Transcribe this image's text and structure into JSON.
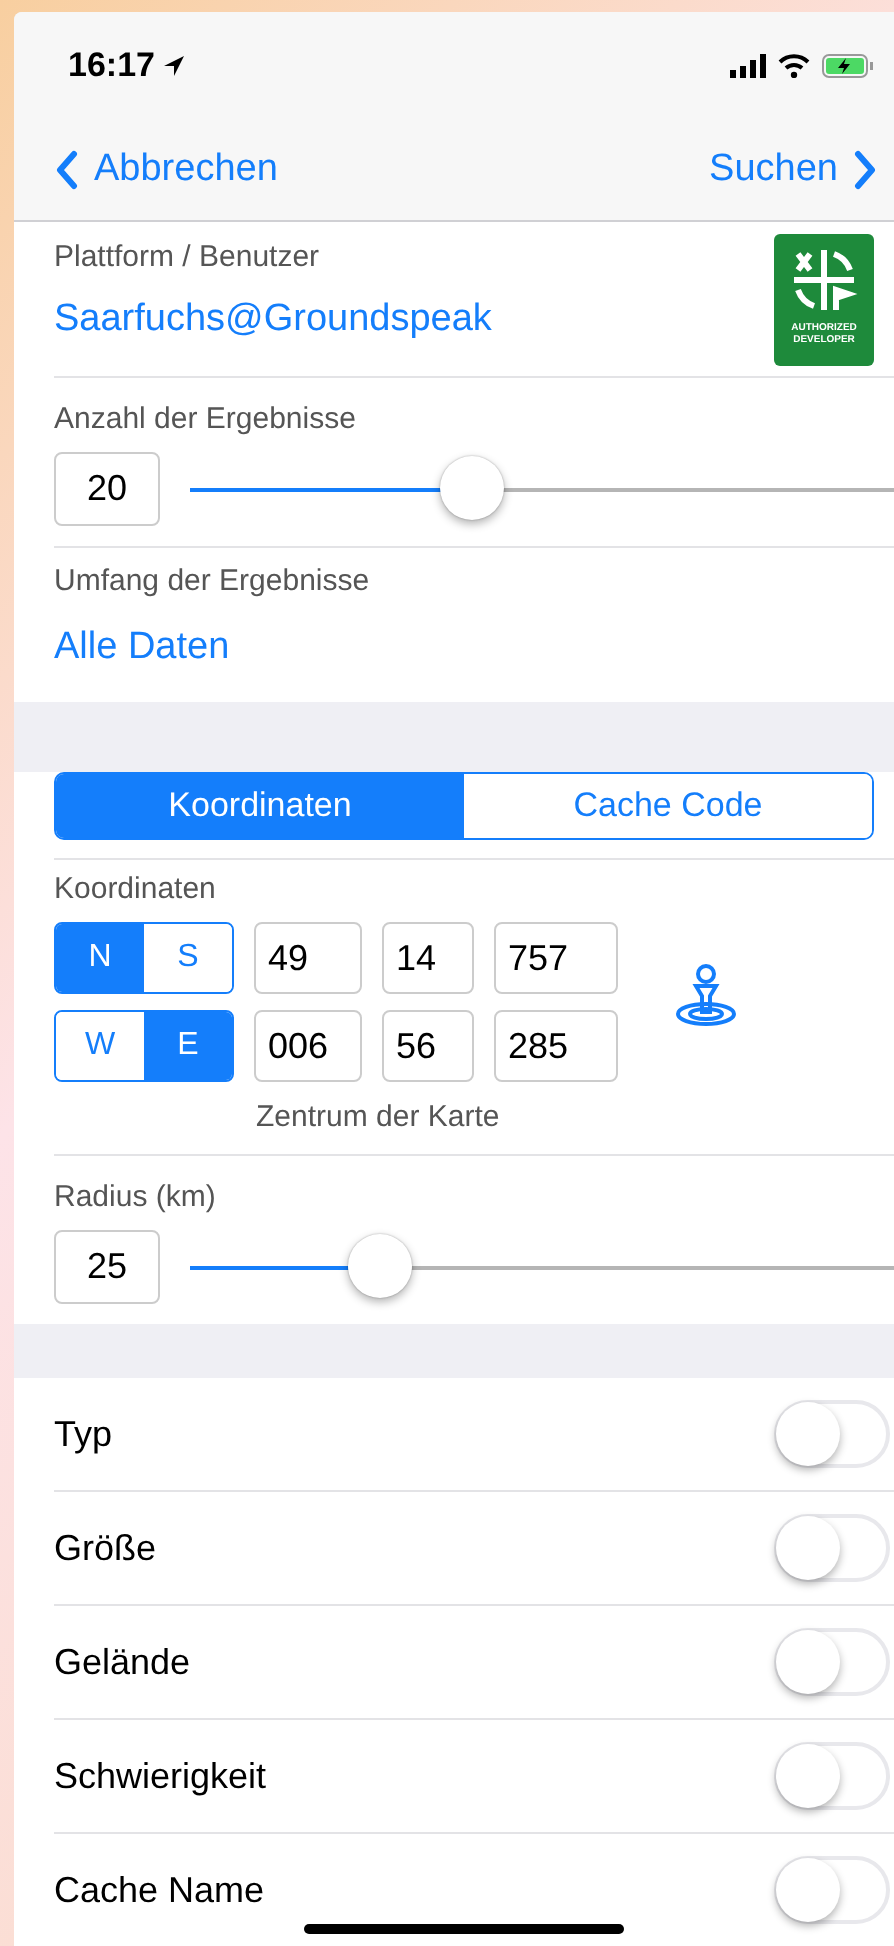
{
  "status_bar": {
    "time": "16:17"
  },
  "nav": {
    "back": "Abbrechen",
    "forward": "Suchen"
  },
  "account": {
    "label": "Plattform / Benutzer",
    "value": "Saarfuchs@Groundspeak",
    "badge_text": "AUTHORIZED DEVELOPER"
  },
  "results": {
    "label": "Anzahl der Ergebnisse",
    "value": "20",
    "level": 0.4
  },
  "scope": {
    "label": "Umfang der Ergebnisse",
    "value": "Alle Daten"
  },
  "mode_tabs": [
    {
      "label": "Koordinaten",
      "selected": true
    },
    {
      "label": "Cache Code",
      "selected": false
    }
  ],
  "coordinates": {
    "label": "Koordinaten",
    "rows": [
      {
        "hemisphere": [
          {
            "label": "N",
            "selected": true
          },
          {
            "label": "S",
            "selected": false
          }
        ],
        "fields": [
          "49",
          "14",
          "757"
        ]
      },
      {
        "hemisphere": [
          {
            "label": "W",
            "selected": false
          },
          {
            "label": "E",
            "selected": true
          }
        ],
        "fields": [
          "006",
          "56",
          "285"
        ]
      }
    ],
    "caption": "Zentrum der Karte"
  },
  "radius": {
    "label": "Radius (km)",
    "value": "25",
    "level": 0.27
  },
  "filters": [
    {
      "label": "Typ",
      "on": false
    },
    {
      "label": "Größe",
      "on": false
    },
    {
      "label": "Gelände",
      "on": false
    },
    {
      "label": "Schwierigkeit",
      "on": false
    },
    {
      "label": "Cache Name",
      "on": false
    }
  ]
}
